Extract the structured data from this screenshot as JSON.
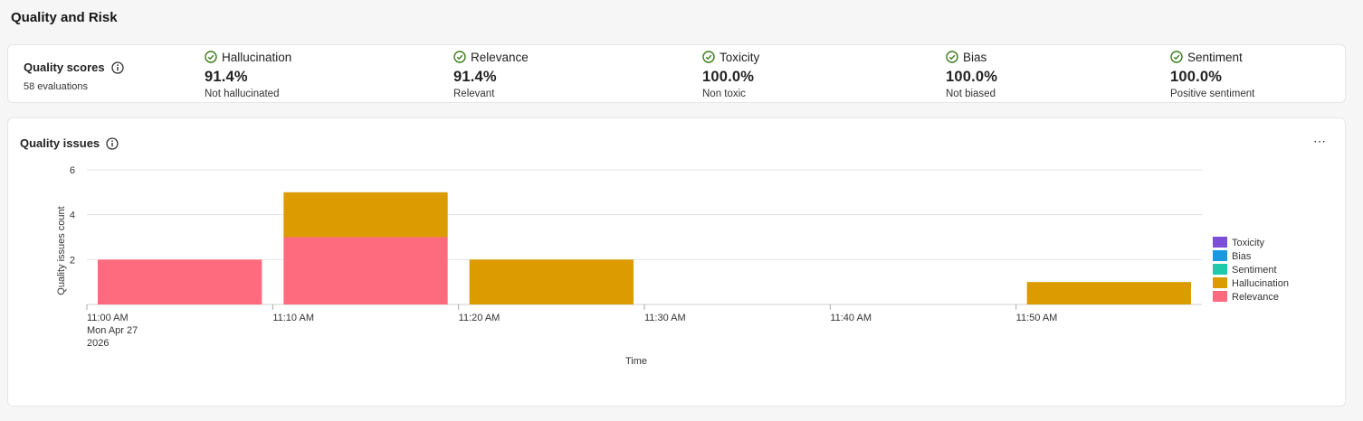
{
  "section": {
    "title": "Quality and Risk"
  },
  "quality_scores": {
    "label": "Quality scores",
    "evaluations": "58 evaluations",
    "metrics": [
      {
        "name": "Hallucination",
        "value": "91.4%",
        "sub": "Not hallucinated"
      },
      {
        "name": "Relevance",
        "value": "91.4%",
        "sub": "Relevant"
      },
      {
        "name": "Toxicity",
        "value": "100.0%",
        "sub": "Non toxic"
      },
      {
        "name": "Bias",
        "value": "100.0%",
        "sub": "Not biased"
      },
      {
        "name": "Sentiment",
        "value": "100.0%",
        "sub": "Positive sentiment"
      }
    ]
  },
  "quality_issues": {
    "title": "Quality issues",
    "more_label": "⋯"
  },
  "chart_data": {
    "type": "bar",
    "stacked": true,
    "xlabel": "Time",
    "ylabel": "Quality issues count",
    "ylim": [
      0,
      6
    ],
    "yticks": [
      "2",
      "4",
      "6"
    ],
    "xticks": [
      "11:00 AM",
      "11:10 AM",
      "11:20 AM",
      "11:30 AM",
      "11:40 AM",
      "11:50 AM"
    ],
    "xtick_date": [
      "Mon Apr 27",
      "2026"
    ],
    "categories": [
      "11:00 AM",
      "11:10 AM",
      "11:20 AM",
      "11:30 AM",
      "11:40 AM",
      "11:50 AM"
    ],
    "series": [
      {
        "name": "Toxicity",
        "color": "#7b4fd8",
        "values": [
          0,
          0,
          0,
          0,
          0,
          0
        ]
      },
      {
        "name": "Bias",
        "color": "#1a98e0",
        "values": [
          0,
          0,
          0,
          0,
          0,
          0
        ]
      },
      {
        "name": "Sentiment",
        "color": "#1fc9aa",
        "values": [
          0,
          0,
          0,
          0,
          0,
          0
        ]
      },
      {
        "name": "Hallucination",
        "color": "#dc9b00",
        "values": [
          0,
          2,
          2,
          0,
          0,
          1
        ]
      },
      {
        "name": "Relevance",
        "color": "#ff6b7e",
        "values": [
          2,
          3,
          0,
          0,
          0,
          0
        ]
      }
    ],
    "grid": true,
    "legend": "right"
  },
  "colors": {
    "check": "#3a7a1a"
  }
}
